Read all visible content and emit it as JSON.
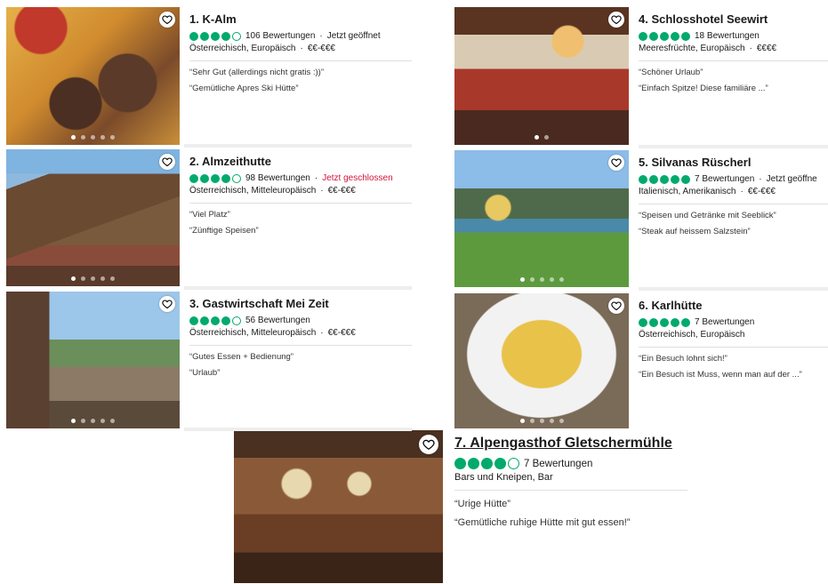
{
  "colors": {
    "bubble": "#00aa6c",
    "closed": "#d4143c"
  },
  "icons": {
    "save": "heart-icon",
    "rating": "bubble-rating-icon"
  },
  "cards": [
    {
      "title": "1. K-Alm",
      "bubbles": 4,
      "reviews": "106 Bewertungen",
      "status": "Jetzt geöffnet",
      "status_type": "open",
      "cuisine": "Österreichisch, Europäisch",
      "price": "€€-€€€",
      "review1": "“Sehr Gut (allerdings nicht gratis :))”",
      "review2": "“Gemütliche Apres Ski Hütte”"
    },
    {
      "title": "2. Almzeithutte",
      "bubbles": 4,
      "reviews": "98 Bewertungen",
      "status": "Jetzt geschlossen",
      "status_type": "closed",
      "cuisine": "Österreichisch, Mitteleuropäisch",
      "price": "€€-€€€",
      "review1": "“Viel Platz”",
      "review2": "“Zünftige Speisen”"
    },
    {
      "title": "3. Gastwirtschaft Mei Zeit",
      "bubbles": 4,
      "reviews": "56 Bewertungen",
      "status": "",
      "status_type": "none",
      "cuisine": "Österreichisch, Mitteleuropäisch",
      "price": "€€-€€€",
      "review1": "“Gutes Essen + Bedienung”",
      "review2": "“Urlaub”"
    },
    {
      "title": "4. Schlosshotel Seewirt",
      "bubbles": 5,
      "reviews": "18 Bewertungen",
      "status": "",
      "status_type": "none",
      "cuisine": "Meeresfrüchte, Europäisch",
      "price": "€€€€",
      "review1": "“Schöner Urlaub”",
      "review2": "“Einfach Spitze! Diese familiäre ...”"
    },
    {
      "title": "5. Silvanas Rüscherl",
      "bubbles": 5,
      "reviews": "7 Bewertungen",
      "status": "Jetzt geöffne",
      "status_type": "open",
      "cuisine": "Italienisch, Amerikanisch",
      "price": "€€-€€€",
      "review1": "“Speisen und Getränke mit Seeblick”",
      "review2": "“Steak auf heissem Salzstein”"
    },
    {
      "title": "6. Karlhütte",
      "bubbles": 5,
      "reviews": "7 Bewertungen",
      "status": "",
      "status_type": "none",
      "cuisine": "Österreichisch, Europäisch",
      "price": "",
      "review1": "“Ein Besuch lohnt sich!”",
      "review2": "“Ein Besuch ist Muss, wenn man auf der ...”"
    },
    {
      "title": "7. Alpengasthof Gletschermühle",
      "bubbles": 4,
      "reviews": "7 Bewertungen",
      "status": "",
      "status_type": "none",
      "cuisine": "Bars und Kneipen, Bar",
      "price": "",
      "review1": "“Urige Hütte”",
      "review2": "“Gemütliche ruhige Hütte mit gut essen!”"
    }
  ]
}
